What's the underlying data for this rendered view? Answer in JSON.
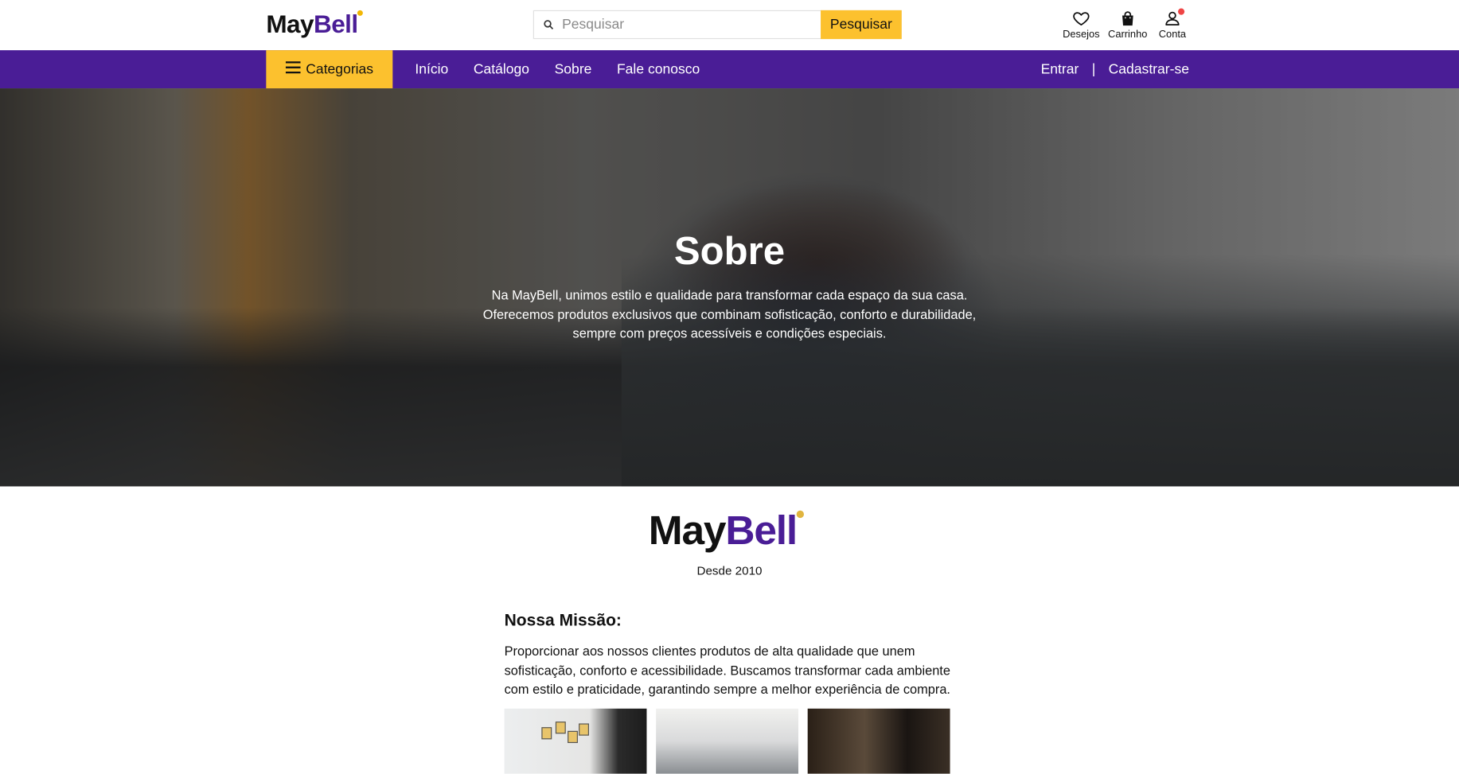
{
  "brand": {
    "name_dark": "May",
    "name_accent": "Bell",
    "accent_color": "#4a1d96",
    "dot_color": "#f2b705"
  },
  "search": {
    "placeholder": "Pesquisar",
    "button_label": "Pesquisar"
  },
  "header_icons": [
    {
      "icon": "heart-icon",
      "label": "Desejos"
    },
    {
      "icon": "bag-icon",
      "label": "Carrinho"
    },
    {
      "icon": "user-icon",
      "label": "Conta"
    }
  ],
  "nav": {
    "categories_label": "Categorias",
    "links": [
      "Início",
      "Catálogo",
      "Sobre",
      "Fale conosco"
    ],
    "login": "Entrar",
    "separator": "|",
    "register": "Cadastrar-se",
    "background_color": "#4a1d96",
    "highlight_color": "#fcc12e"
  },
  "hero": {
    "title": "Sobre",
    "text": "Na MayBell, unimos estilo e qualidade para transformar cada espaço da sua casa. Oferecemos produtos exclusivos que combinam sofisticação, conforto e durabilidade, sempre com preços acessíveis e condições especiais."
  },
  "about": {
    "since": "Desde 2010",
    "mission_title": "Nossa Missão:",
    "mission_text": "Proporcionar aos nossos clientes produtos de alta qualidade que unem sofisticação, conforto e acessibilidade. Buscamos transformar cada ambiente com estilo e praticidade, garantindo sempre a melhor experiência de compra."
  }
}
